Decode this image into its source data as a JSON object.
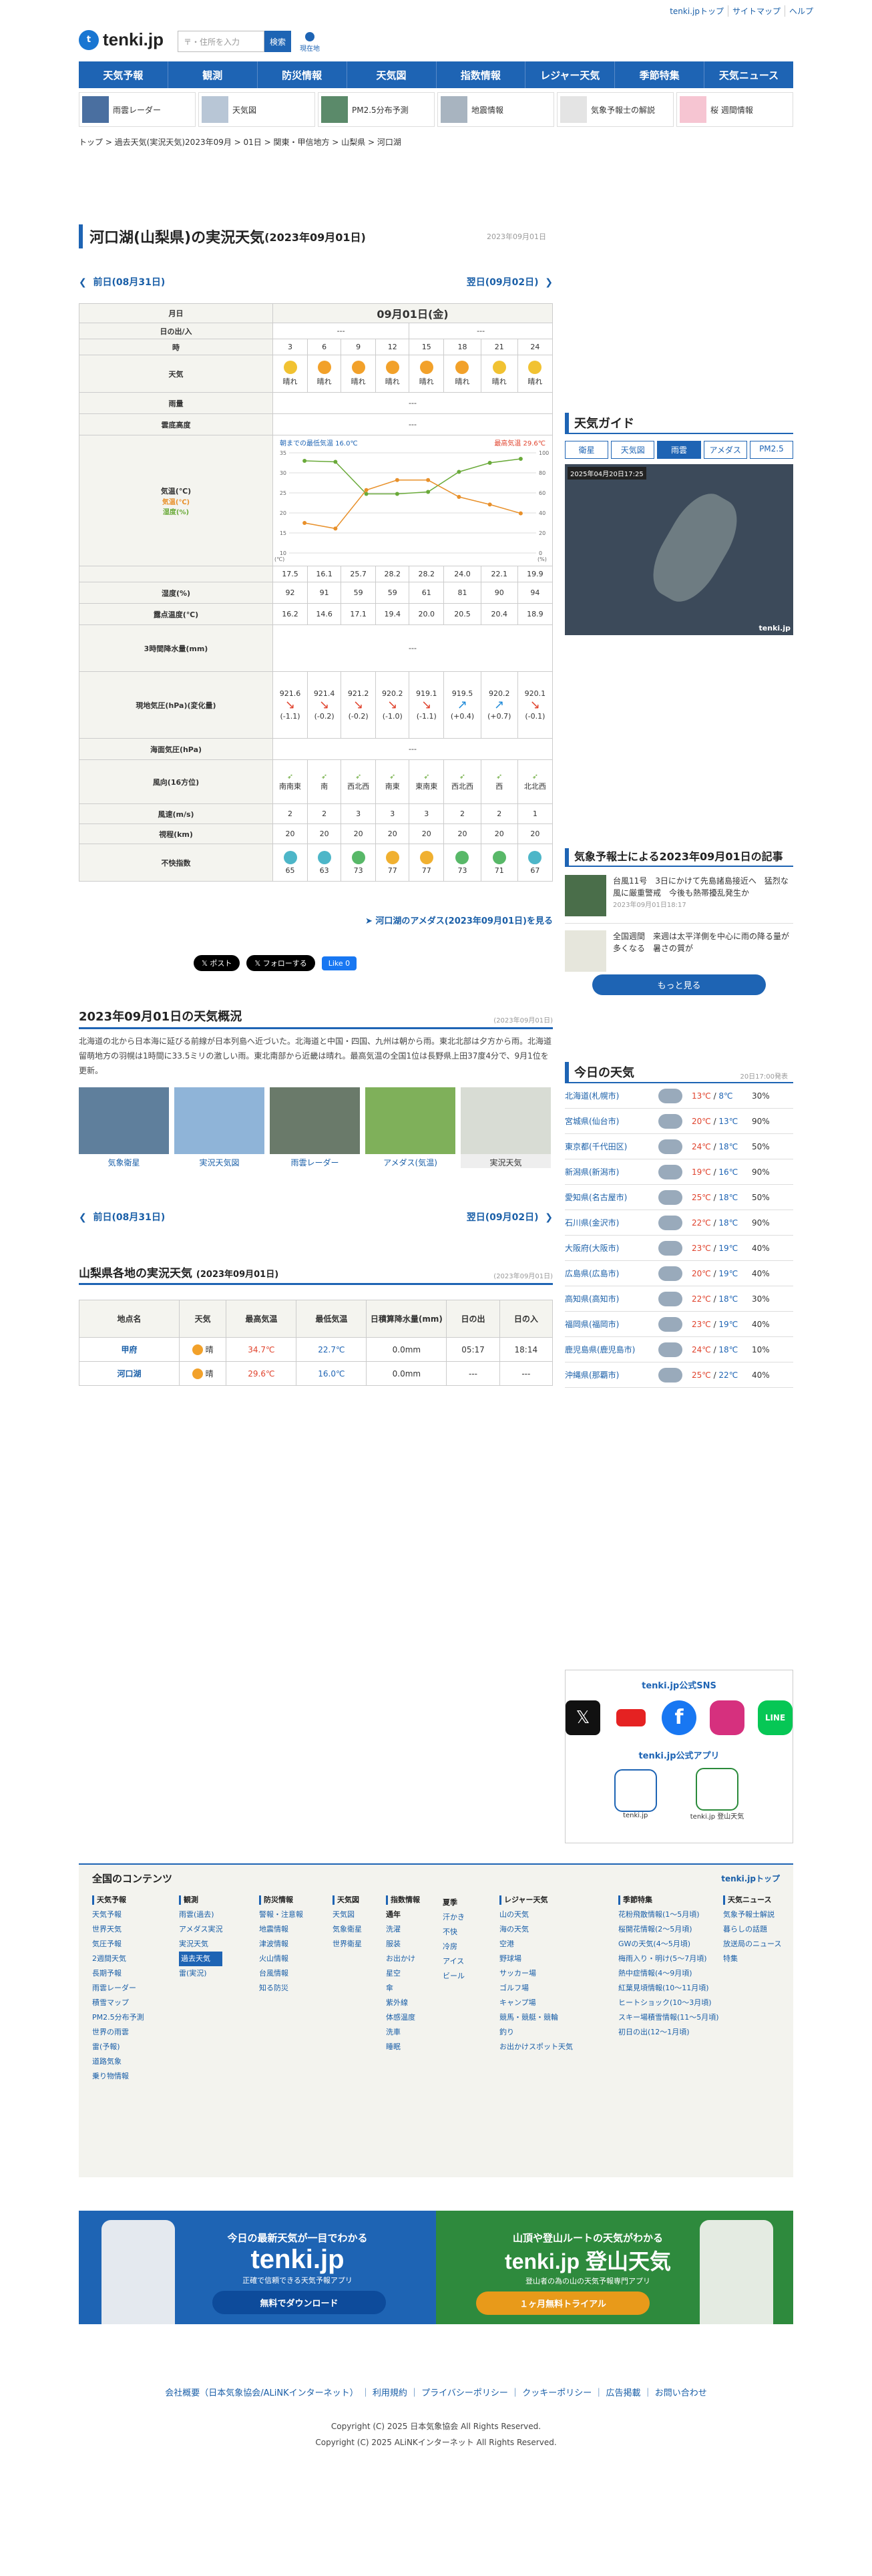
{
  "header": {
    "toplinks": [
      "tenki.jpトップ",
      "サイトマップ",
      "ヘルプ"
    ],
    "logo": "tenki.jp",
    "search_placeholder": "〒・住所を入力",
    "search_button": "検索",
    "location_button": "現在地"
  },
  "nav": [
    "天気予報",
    "観測",
    "防災情報",
    "天気図",
    "指数情報",
    "レジャー天気",
    "季節特集",
    "天気ニュース"
  ],
  "subnav": [
    "雨雲レーダー",
    "天気図",
    "PM2.5分布予測",
    "地震情報",
    "気象予報士の解説",
    "桜 週間情報"
  ],
  "breadcrumb": "トップ > 過去天気(実況天気)2023年09月 > 01日 > 関東・甲信地方 > 山梨県 > 河口湖",
  "page": {
    "title": "河口湖(山梨県)の実況天気",
    "title_date": "(2023年09月01日)",
    "update": "2023年09月01日",
    "prev": "前日(08月31日)",
    "next": "翌日(09月02日)"
  },
  "table": {
    "date_label": "月日",
    "date": "09月01日(金)",
    "sun_label": "日の出/入",
    "sun_value": "---",
    "hour_label": "時",
    "hours": [
      "3",
      "6",
      "9",
      "12",
      "15",
      "18",
      "21",
      "24"
    ],
    "weather_label": "天気",
    "weather": [
      "晴れ",
      "晴れ",
      "晴れ",
      "晴れ",
      "晴れ",
      "晴れ",
      "晴れ",
      "晴れ"
    ],
    "rain_label": "雨量",
    "cloud_label": "雲底高度",
    "temp_label": "気温(℃)",
    "min_text": "朝までの最低気温 16.0℃",
    "max_text": "最高気温 29.6℃",
    "temps": [
      "17.5",
      "16.1",
      "25.7",
      "28.2",
      "28.2",
      "24.0",
      "22.1",
      "19.9"
    ],
    "humid_label": "湿度(%)",
    "humid": [
      "92",
      "91",
      "59",
      "59",
      "61",
      "81",
      "90",
      "94"
    ],
    "dew_label": "露点温度(℃)",
    "dew": [
      "16.2",
      "14.6",
      "17.1",
      "19.4",
      "20.0",
      "20.5",
      "20.4",
      "18.9"
    ],
    "rain3_label": "3時間降水量(mm)",
    "pressure_label": "現地気圧(hPa)(変化量)",
    "pressure": [
      "921.6",
      "921.4",
      "921.2",
      "920.2",
      "919.1",
      "919.5",
      "920.2",
      "920.1"
    ],
    "pressure_change": [
      "(-1.1)",
      "(-0.2)",
      "(-0.2)",
      "(-1.0)",
      "(-1.1)",
      "(+0.4)",
      "(+0.7)",
      "(-0.1)"
    ],
    "sea_label": "海面気圧(hPa)",
    "wind_dir_label": "風向(16方位)",
    "wind_dir": [
      "南南東",
      "南",
      "西北西",
      "南東",
      "東南東",
      "西北西",
      "西",
      "北北西"
    ],
    "wind_speed_label": "風速(m/s)",
    "wind_speed": [
      "2",
      "2",
      "3",
      "3",
      "3",
      "2",
      "2",
      "1"
    ],
    "vis_label": "視程(km)",
    "vis": [
      "20",
      "20",
      "20",
      "20",
      "20",
      "20",
      "20",
      "20"
    ],
    "discomfort_label": "不快指数",
    "discomfort": [
      "65",
      "63",
      "73",
      "77",
      "77",
      "73",
      "71",
      "67"
    ],
    "amedas_link": "河口湖のアメダス(2023年09月01日)を見る",
    "dash": "---"
  },
  "social": {
    "post": "ポスト",
    "follow": "フォローする",
    "like": "Like 0"
  },
  "overview": {
    "title": "2023年09月01日の天気概況",
    "date": "(2023年09月01日)",
    "text": "北海道の北から日本海に延びる前線が日本列島へ近づいた。北海道と中国・四国、九州は朝から雨。東北北部は夕方から雨。北海道留萌地方の羽幌は1時間に33.5ミリの激しい雨。東北南部から近畿は晴れ。最高気温の全国1位は長野県上田37度4分で、9月1位を更新。",
    "thumbs": [
      "気象衛星",
      "実況天気図",
      "雨雲レーダー",
      "アメダス(気温)",
      "実況天気"
    ]
  },
  "pref": {
    "title": "山梨県各地の実況天気",
    "title_date": "(2023年09月01日)",
    "date": "(2023年09月01日)",
    "headers": [
      "地点名",
      "天気",
      "最高気温",
      "最低気温",
      "日積算降水量(mm)",
      "日の出",
      "日の入"
    ],
    "rows": [
      {
        "name": "甲府",
        "weather": "晴",
        "max": "34.7℃",
        "min": "22.7℃",
        "rain": "0.0mm",
        "rise": "05:17",
        "set": "18:14"
      },
      {
        "name": "河口湖",
        "weather": "晴",
        "max": "29.6℃",
        "min": "16.0℃",
        "rain": "0.0mm",
        "rise": "---",
        "set": "---"
      }
    ]
  },
  "sidebar": {
    "guide_title": "天気ガイド",
    "tabs": [
      "衛星",
      "天気図",
      "雨雲",
      "アメダス",
      "PM2.5"
    ],
    "radar_time": "2025年04月20日17:25",
    "radar_logo": "tenki.jp",
    "yoho_title": "気象予報士による2023年09月01日の記事",
    "articles": [
      {
        "title": "台風11号　3日にかけて先島諸島接近へ　猛烈な風に厳重警戒　今後も熱帯擾乱発生か",
        "time": "2023年09月01日18:17"
      },
      {
        "title": "全国週間　来週は太平洋側を中心に雨の降る量が多くなる　暑さの質が",
        "time": ""
      }
    ],
    "more": "もっと見る",
    "today_title": "今日の天気",
    "today_time": "20日17:00発表",
    "cities": [
      {
        "c": "北海道(札幌市)",
        "h": "13℃",
        "l": "8℃",
        "p": "30%"
      },
      {
        "c": "宮城県(仙台市)",
        "h": "20℃",
        "l": "13℃",
        "p": "90%"
      },
      {
        "c": "東京都(千代田区)",
        "h": "24℃",
        "l": "18℃",
        "p": "50%"
      },
      {
        "c": "新潟県(新潟市)",
        "h": "19℃",
        "l": "16℃",
        "p": "90%"
      },
      {
        "c": "愛知県(名古屋市)",
        "h": "25℃",
        "l": "18℃",
        "p": "50%"
      },
      {
        "c": "石川県(金沢市)",
        "h": "22℃",
        "l": "18℃",
        "p": "90%"
      },
      {
        "c": "大阪府(大阪市)",
        "h": "23℃",
        "l": "19℃",
        "p": "40%"
      },
      {
        "c": "広島県(広島市)",
        "h": "20℃",
        "l": "19℃",
        "p": "40%"
      },
      {
        "c": "高知県(高知市)",
        "h": "22℃",
        "l": "18℃",
        "p": "30%"
      },
      {
        "c": "福岡県(福岡市)",
        "h": "23℃",
        "l": "19℃",
        "p": "40%"
      },
      {
        "c": "鹿児島県(鹿児島市)",
        "h": "24℃",
        "l": "18℃",
        "p": "10%"
      },
      {
        "c": "沖縄県(那覇市)",
        "h": "25℃",
        "l": "22℃",
        "p": "40%"
      }
    ],
    "sns_title": "tenki.jp公式SNS",
    "app_title": "tenki.jp公式アプリ",
    "apps": [
      "tenki.jp",
      "tenki.jp 登山天気"
    ]
  },
  "footer": {
    "title": "全国のコンテンツ",
    "top_link": "tenki.jpトップ",
    "cols": [
      {
        "h": "天気予報",
        "items": [
          "天気予報",
          "世界天気",
          "気圧予報",
          "2週間天気",
          "長期予報",
          "雨雲レーダー",
          "積雪マップ",
          "PM2.5分布予測",
          "世界の雨雲",
          "雷(予報)",
          "道路気象",
          "乗り物情報"
        ]
      },
      {
        "h": "観測",
        "items": [
          "雨雲(過去)",
          "アメダス実況",
          "実況天気",
          "過去天気",
          "雷(実況)"
        ]
      },
      {
        "h": "防災情報",
        "items": [
          "警報・注意報",
          "地震情報",
          "津波情報",
          "火山情報",
          "台風情報",
          "知る防災"
        ]
      },
      {
        "h": "天気図",
        "items": [
          "天気図",
          "気象衛星",
          "世界衛星"
        ]
      },
      {
        "h": "指数情報",
        "items": [
          "通年",
          "洗濯",
          "服装",
          "お出かけ",
          "星空",
          "傘",
          "紫外線",
          "体感温度",
          "洗車",
          "睡眠"
        ]
      },
      {
        "h": "",
        "items": [
          "夏季",
          "汗かき",
          "不快",
          "冷房",
          "アイス",
          "ビール"
        ]
      },
      {
        "h": "レジャー天気",
        "items": [
          "山の天気",
          "海の天気",
          "空港",
          "野球場",
          "サッカー場",
          "ゴルフ場",
          "キャンプ場",
          "競馬・競艇・競輪",
          "釣り",
          "お出かけスポット天気"
        ]
      },
      {
        "h": "季節特集",
        "items": [
          "花粉飛散情報(1〜5月頃)",
          "桜開花情報(2〜5月頃)",
          "GWの天気(4〜5月頃)",
          "梅雨入り・明け(5〜7月頃)",
          "熱中症情報(4〜9月頃)",
          "紅葉見頃情報(10〜11月頃)",
          "ヒートショック(10〜3月頃)",
          "スキー場積雪情報(11〜5月頃)",
          "初日の出(12〜1月頃)"
        ]
      },
      {
        "h": "天気ニュース",
        "items": [
          "気象予報士解説",
          "暮らしの話題",
          "放送局のニュース",
          "特集"
        ]
      }
    ]
  },
  "banners": [
    {
      "top": "今日の最新天気が一目でわかる",
      "logo": "tenki.jp",
      "sub": "正確で信頼できる天気予報アプリ",
      "btn": "無料でダウンロード"
    },
    {
      "top": "山頂や登山ルートの天気がわかる",
      "logo": "tenki.jp 登山天気",
      "sub": "登山者の為の山の天気予報専門アプリ",
      "btn": "１ヶ月無料トライアル"
    }
  ],
  "bottom": {
    "links": [
      "会社概要（日本気象協会/ALiNKインターネット）",
      "利用規約",
      "プライバシーポリシー",
      "クッキーポリシー",
      "広告掲載",
      "お問い合わせ"
    ],
    "copy1": "Copyright (C) 2025 日本気象協会 All Rights Reserved.",
    "copy2": "Copyright (C) 2025 ALiNKインターネット All Rights Reserved."
  },
  "chart_data": {
    "type": "line",
    "categories": [
      "3",
      "6",
      "9",
      "12",
      "15",
      "18",
      "21",
      "24"
    ],
    "series": [
      {
        "name": "気温(℃)",
        "values": [
          17.5,
          16.1,
          25.7,
          28.2,
          28.2,
          24.0,
          22.1,
          19.9
        ]
      },
      {
        "name": "湿度(%)",
        "values": [
          92,
          91,
          59,
          59,
          61,
          81,
          90,
          94
        ]
      }
    ],
    "ylim": [
      10,
      35
    ],
    "y2lim": [
      0,
      100
    ],
    "colors": [
      "#e8902a",
      "#6aaa3a"
    ],
    "ylabel": "(℃)",
    "y2label": "(%)"
  }
}
